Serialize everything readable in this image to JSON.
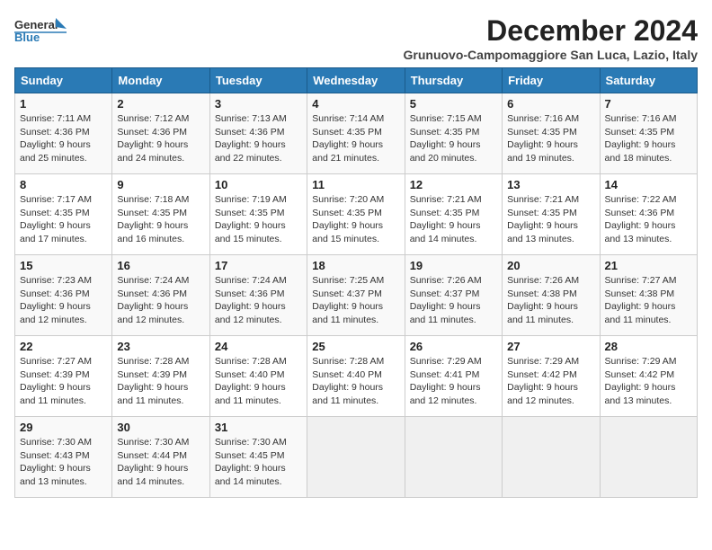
{
  "logo": {
    "line1": "General",
    "line2": "Blue"
  },
  "title": "December 2024",
  "subtitle": "Grunuovo-Campomaggiore San Luca, Lazio, Italy",
  "days_of_week": [
    "Sunday",
    "Monday",
    "Tuesday",
    "Wednesday",
    "Thursday",
    "Friday",
    "Saturday"
  ],
  "weeks": [
    [
      {
        "day": 1,
        "info": "Sunrise: 7:11 AM\nSunset: 4:36 PM\nDaylight: 9 hours and 25 minutes."
      },
      {
        "day": 2,
        "info": "Sunrise: 7:12 AM\nSunset: 4:36 PM\nDaylight: 9 hours and 24 minutes."
      },
      {
        "day": 3,
        "info": "Sunrise: 7:13 AM\nSunset: 4:36 PM\nDaylight: 9 hours and 22 minutes."
      },
      {
        "day": 4,
        "info": "Sunrise: 7:14 AM\nSunset: 4:35 PM\nDaylight: 9 hours and 21 minutes."
      },
      {
        "day": 5,
        "info": "Sunrise: 7:15 AM\nSunset: 4:35 PM\nDaylight: 9 hours and 20 minutes."
      },
      {
        "day": 6,
        "info": "Sunrise: 7:16 AM\nSunset: 4:35 PM\nDaylight: 9 hours and 19 minutes."
      },
      {
        "day": 7,
        "info": "Sunrise: 7:16 AM\nSunset: 4:35 PM\nDaylight: 9 hours and 18 minutes."
      }
    ],
    [
      {
        "day": 8,
        "info": "Sunrise: 7:17 AM\nSunset: 4:35 PM\nDaylight: 9 hours and 17 minutes."
      },
      {
        "day": 9,
        "info": "Sunrise: 7:18 AM\nSunset: 4:35 PM\nDaylight: 9 hours and 16 minutes."
      },
      {
        "day": 10,
        "info": "Sunrise: 7:19 AM\nSunset: 4:35 PM\nDaylight: 9 hours and 15 minutes."
      },
      {
        "day": 11,
        "info": "Sunrise: 7:20 AM\nSunset: 4:35 PM\nDaylight: 9 hours and 15 minutes."
      },
      {
        "day": 12,
        "info": "Sunrise: 7:21 AM\nSunset: 4:35 PM\nDaylight: 9 hours and 14 minutes."
      },
      {
        "day": 13,
        "info": "Sunrise: 7:21 AM\nSunset: 4:35 PM\nDaylight: 9 hours and 13 minutes."
      },
      {
        "day": 14,
        "info": "Sunrise: 7:22 AM\nSunset: 4:36 PM\nDaylight: 9 hours and 13 minutes."
      }
    ],
    [
      {
        "day": 15,
        "info": "Sunrise: 7:23 AM\nSunset: 4:36 PM\nDaylight: 9 hours and 12 minutes."
      },
      {
        "day": 16,
        "info": "Sunrise: 7:24 AM\nSunset: 4:36 PM\nDaylight: 9 hours and 12 minutes."
      },
      {
        "day": 17,
        "info": "Sunrise: 7:24 AM\nSunset: 4:36 PM\nDaylight: 9 hours and 12 minutes."
      },
      {
        "day": 18,
        "info": "Sunrise: 7:25 AM\nSunset: 4:37 PM\nDaylight: 9 hours and 11 minutes."
      },
      {
        "day": 19,
        "info": "Sunrise: 7:26 AM\nSunset: 4:37 PM\nDaylight: 9 hours and 11 minutes."
      },
      {
        "day": 20,
        "info": "Sunrise: 7:26 AM\nSunset: 4:38 PM\nDaylight: 9 hours and 11 minutes."
      },
      {
        "day": 21,
        "info": "Sunrise: 7:27 AM\nSunset: 4:38 PM\nDaylight: 9 hours and 11 minutes."
      }
    ],
    [
      {
        "day": 22,
        "info": "Sunrise: 7:27 AM\nSunset: 4:39 PM\nDaylight: 9 hours and 11 minutes."
      },
      {
        "day": 23,
        "info": "Sunrise: 7:28 AM\nSunset: 4:39 PM\nDaylight: 9 hours and 11 minutes."
      },
      {
        "day": 24,
        "info": "Sunrise: 7:28 AM\nSunset: 4:40 PM\nDaylight: 9 hours and 11 minutes."
      },
      {
        "day": 25,
        "info": "Sunrise: 7:28 AM\nSunset: 4:40 PM\nDaylight: 9 hours and 11 minutes."
      },
      {
        "day": 26,
        "info": "Sunrise: 7:29 AM\nSunset: 4:41 PM\nDaylight: 9 hours and 12 minutes."
      },
      {
        "day": 27,
        "info": "Sunrise: 7:29 AM\nSunset: 4:42 PM\nDaylight: 9 hours and 12 minutes."
      },
      {
        "day": 28,
        "info": "Sunrise: 7:29 AM\nSunset: 4:42 PM\nDaylight: 9 hours and 13 minutes."
      }
    ],
    [
      {
        "day": 29,
        "info": "Sunrise: 7:30 AM\nSunset: 4:43 PM\nDaylight: 9 hours and 13 minutes."
      },
      {
        "day": 30,
        "info": "Sunrise: 7:30 AM\nSunset: 4:44 PM\nDaylight: 9 hours and 14 minutes."
      },
      {
        "day": 31,
        "info": "Sunrise: 7:30 AM\nSunset: 4:45 PM\nDaylight: 9 hours and 14 minutes."
      },
      null,
      null,
      null,
      null
    ]
  ]
}
